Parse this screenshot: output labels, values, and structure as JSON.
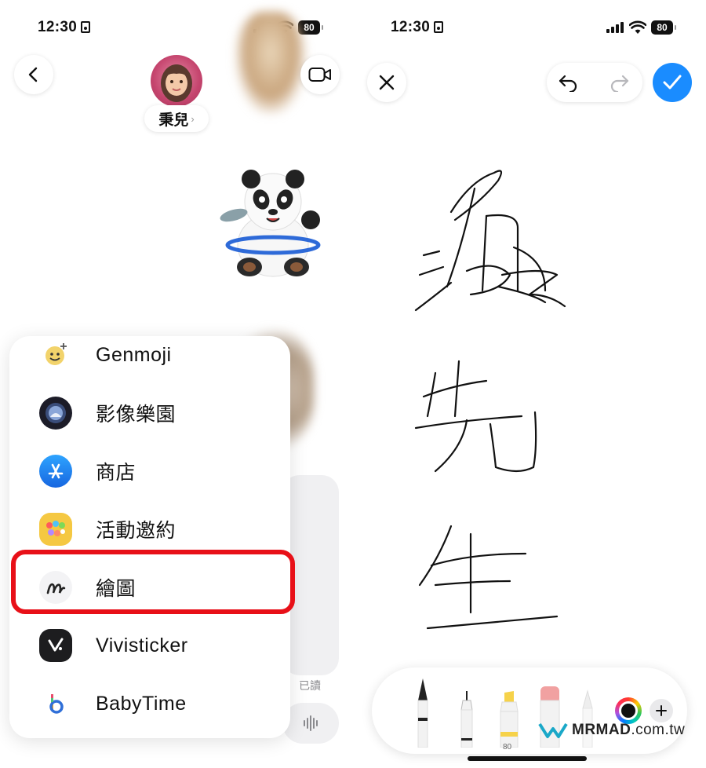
{
  "status_bar": {
    "time": "12:30",
    "battery": "80"
  },
  "conversation": {
    "contact_name": "秉兒"
  },
  "app_menu": {
    "items": [
      {
        "label": "Genmoji",
        "icon": "genmoji-icon"
      },
      {
        "label": "影像樂園",
        "icon": "image-playground-icon"
      },
      {
        "label": "商店",
        "icon": "app-store-icon"
      },
      {
        "label": "活動邀約",
        "icon": "invites-icon"
      },
      {
        "label": "繪圖",
        "icon": "drawing-icon",
        "highlighted": true
      },
      {
        "label": "Vivisticker",
        "icon": "vivisticker-icon"
      },
      {
        "label": "BabyTime",
        "icon": "babytime-icon"
      }
    ]
  },
  "message_status": "已讀",
  "drawing": {
    "handwriting": [
      "瘋",
      "先",
      "生"
    ],
    "tools": [
      "pen",
      "fineliner",
      "marker",
      "eraser",
      "pencil"
    ],
    "marker_size": "80"
  },
  "watermark": {
    "brand": "MRMAD",
    "domain": ".com.tw"
  },
  "colors": {
    "accent": "#1a8cff",
    "highlight": "#e81018"
  }
}
